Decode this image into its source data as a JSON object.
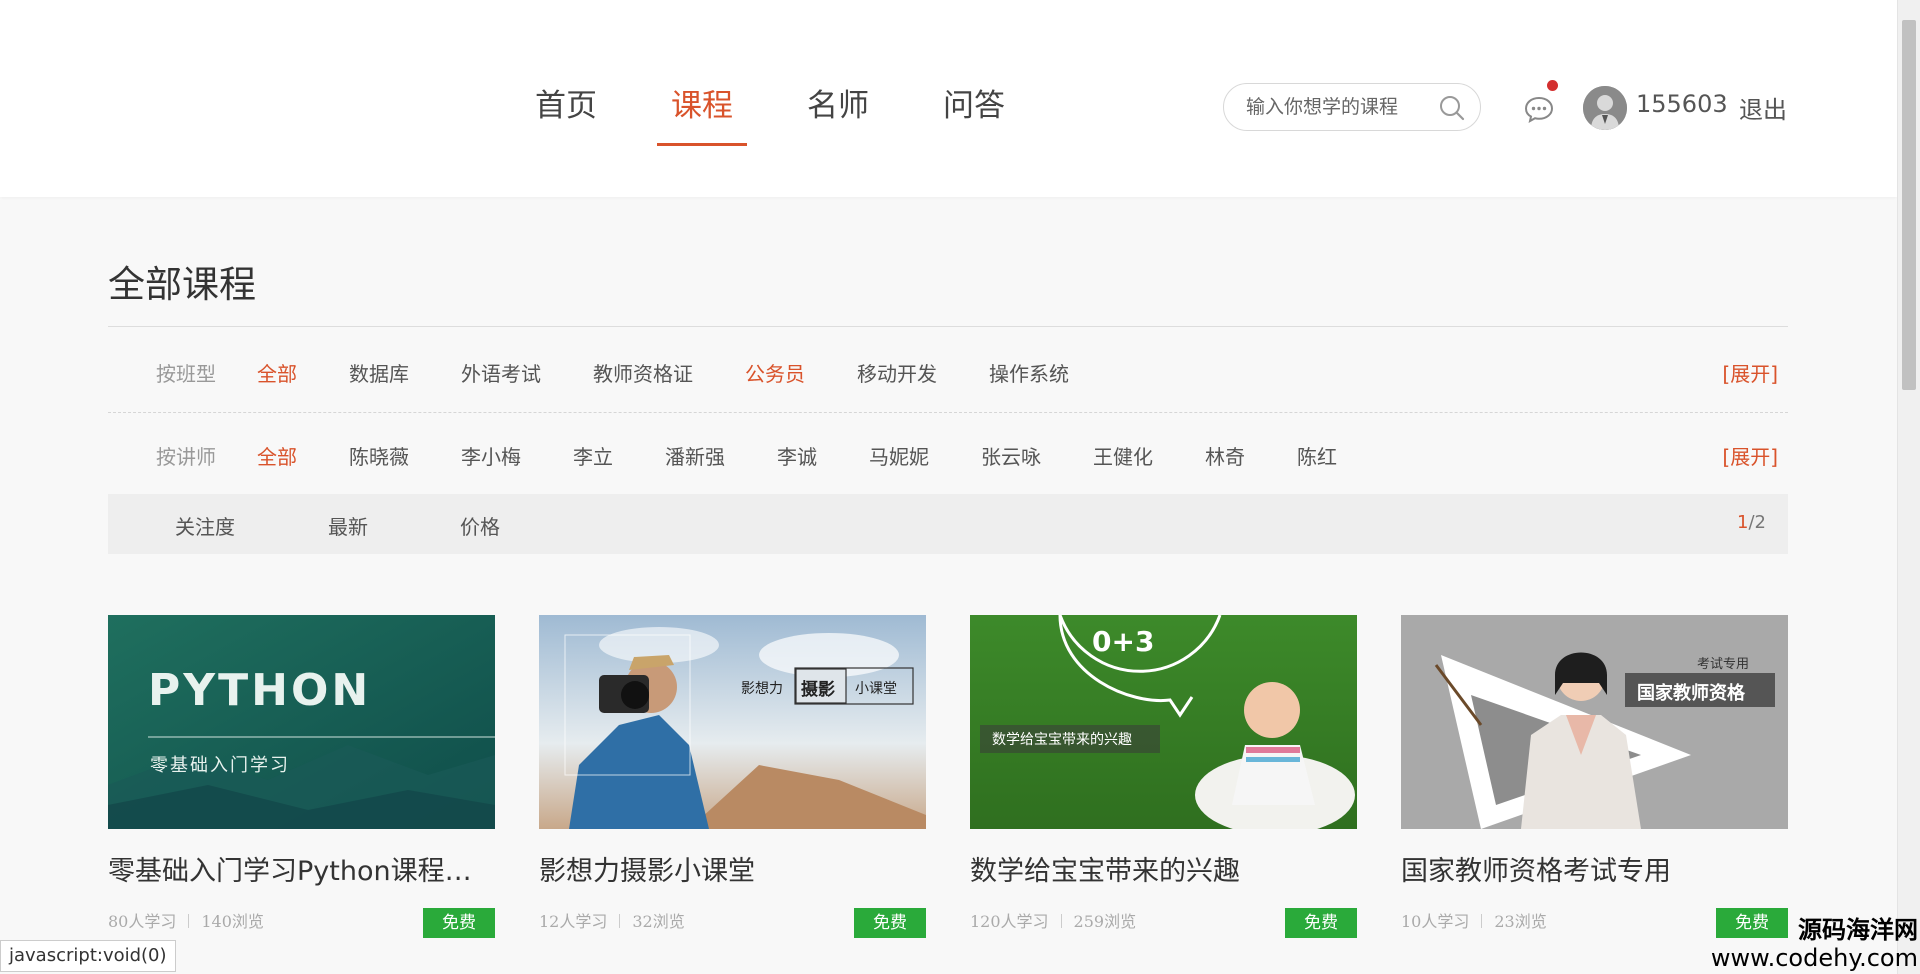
{
  "header": {
    "nav": [
      {
        "label": "首页",
        "active": false
      },
      {
        "label": "课程",
        "active": true
      },
      {
        "label": "名师",
        "active": false
      },
      {
        "label": "问答",
        "active": false
      }
    ],
    "search_placeholder": "输入你想学的课程",
    "username": "155603",
    "logout": "退出"
  },
  "page_title": "全部课程",
  "filters": {
    "class_type": {
      "label": "按班型",
      "items": [
        "全部",
        "数据库",
        "外语考试",
        "教师资格证",
        "公务员",
        "移动开发",
        "操作系统"
      ],
      "active": [
        "全部",
        "公务员"
      ],
      "expand": "[展开]"
    },
    "teacher": {
      "label": "按讲师",
      "items": [
        "全部",
        "陈晓薇",
        "李小梅",
        "李立",
        "潘新强",
        "李诚",
        "马妮妮",
        "张云咏",
        "王健化",
        "林奇",
        "陈红"
      ],
      "active": [
        "全部"
      ],
      "expand": "[展开]"
    }
  },
  "sort": {
    "items": [
      "关注度",
      "最新",
      "价格"
    ],
    "page_current": "1",
    "page_sep": "/",
    "page_total": "2"
  },
  "courses": [
    {
      "title": "零基础入门学习Python课程学习",
      "learners": "80人学习",
      "views": "140浏览",
      "badge": "免费",
      "thumb": {
        "big": "PYTHON",
        "sub": "零基础入门学习"
      }
    },
    {
      "title": "影想力摄影小课堂",
      "learners": "12人学习",
      "views": "32浏览",
      "badge": "免费",
      "thumb": {
        "a": "影想力",
        "b": "摄影",
        "c": "小课堂"
      }
    },
    {
      "title": "数学给宝宝带来的兴趣",
      "learners": "120人学习",
      "views": "259浏览",
      "badge": "免费",
      "thumb": {
        "caption": "数学给宝宝带来的兴趣",
        "math": "0+3"
      }
    },
    {
      "title": "国家教师资格考试专用",
      "learners": "10人学习",
      "views": "23浏览",
      "badge": "免费",
      "thumb": {
        "tag": "考试专用",
        "banner": "国家教师资格"
      }
    }
  ],
  "status_text": "javascript:void(0)",
  "watermark": {
    "line1": "源码海洋网",
    "line2": "www.codehy.com"
  },
  "colors": {
    "accent": "#d9532b",
    "free_badge": "#2aaa3a"
  }
}
